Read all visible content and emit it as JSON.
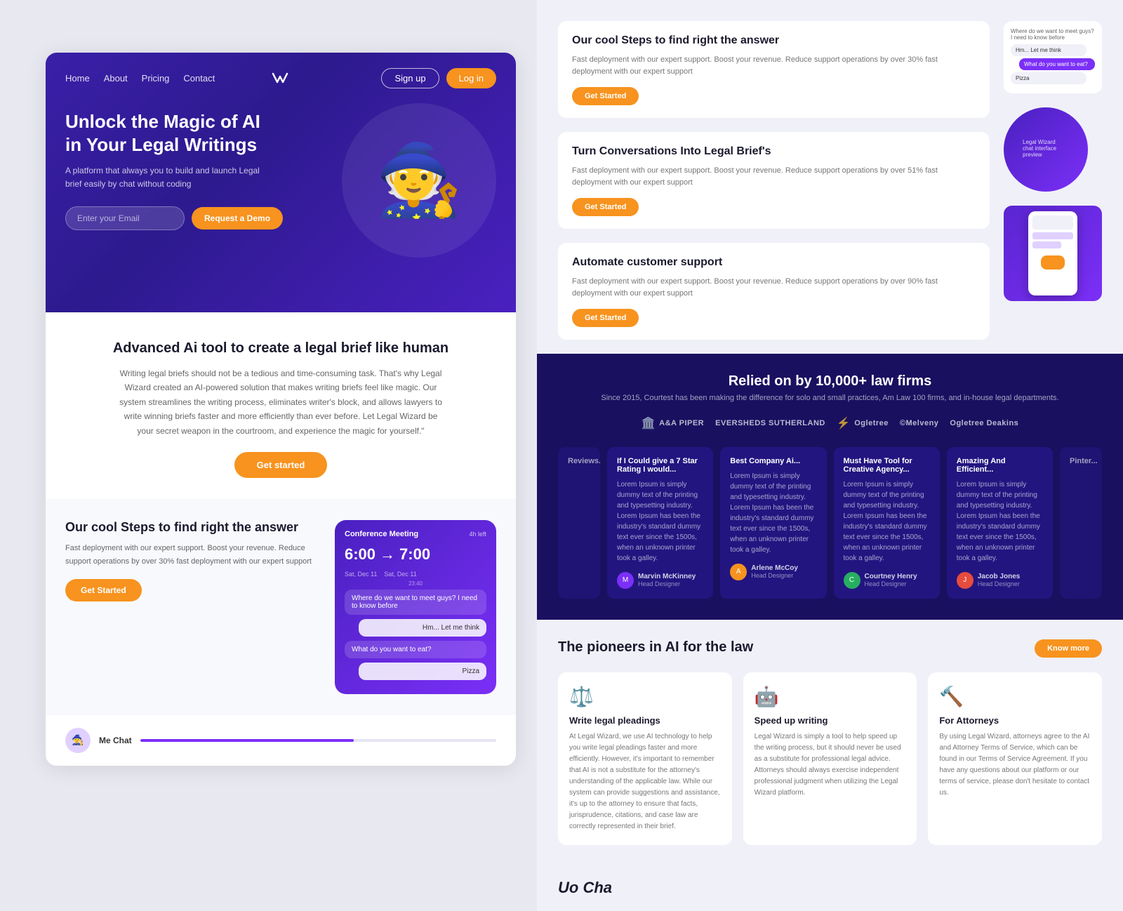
{
  "nav": {
    "links": [
      "Home",
      "About",
      "Pricing",
      "Contact"
    ],
    "signup_label": "Sign up",
    "login_label": "Log in"
  },
  "hero": {
    "title": "Unlock the Magic of AI in Your Legal Writings",
    "subtitle": "A platform that always you to build and launch Legal brief easily by chat without coding",
    "email_placeholder": "Enter your Email",
    "demo_button": "Request a Demo"
  },
  "middle": {
    "title": "Advanced Ai tool to create a legal brief like human",
    "description": "Writing legal briefs should not be a tedious and time-consuming task. That's why Legal Wizard created an AI-powered solution that makes writing briefs feel like magic. Our system streamlines the writing process, eliminates writer's block, and allows lawyers to write winning briefs faster and more efficiently than ever before. Let Legal Wizard be your secret weapon in the courtroom, and experience the magic for yourself.\"",
    "cta_button": "Get started"
  },
  "steps": {
    "title": "Our cool Steps to find right the answer",
    "description": "Fast deployment with our expert support. Boost your revenue. Reduce support operations by over 30% fast deployment with our expert support",
    "cta_button": "Get Started",
    "mockup": {
      "title": "Conference Meeting",
      "time_ago": "4h left",
      "start_time": "6:00",
      "end_time": "7:00",
      "start_date": "Sat, Dec 11",
      "end_date": "Sat, Dec 11",
      "timestamp": "23:40",
      "msg1": "Where do we want to meet guys? I need to know before",
      "msg2": "Hm... Let me think",
      "msg3": "What do you want to eat?",
      "msg4": "Pizza"
    }
  },
  "right_features": [
    {
      "id": "steps",
      "title": "Our cool Steps to find right the answer",
      "description": "Fast deployment with our expert support. Boost your revenue. Reduce support operations by over 30% fast deployment with our expert support",
      "cta": "Get Started"
    },
    {
      "id": "conversations",
      "title": "Turn Conversations Into Legal Brief's",
      "description": "Fast deployment with our expert support. Boost your revenue. Reduce support operations by over 51% fast deployment with our expert support",
      "cta": "Get Started"
    },
    {
      "id": "automate",
      "title": "Automate customer support",
      "description": "Fast deployment with our expert support. Boost your revenue. Reduce support operations by over 90% fast deployment with our expert support",
      "cta": "Get Started"
    }
  ],
  "relied": {
    "title": "Relied on by 10,000+ law firms",
    "subtitle": "Since 2015, Courtest has been making the difference for solo and small practices, Am Law 100 firms, and in-house legal departments.",
    "logos": [
      "A&A PIPER",
      "EVERSHEDS SUTHERLAND",
      "Ogletree",
      "Ogletree Deakins",
      "©Melveny"
    ],
    "testimonials": [
      {
        "title": "If I Could give a 7 Star Rating I would...",
        "description": "Lorem Ipsum is simply dummy text of the printing and typesetting industry. Lorem Ipsum has been the industry's standard dummy text ever since the 1500s, when an unknown printer took a galley.",
        "author": "Marvin McKinney",
        "role": "Head Designer"
      },
      {
        "title": "Best Company Ai...",
        "description": "Lorem Ipsum is simply dummy text of the printing and typesetting industry. Lorem Ipsum has been the industry's standard dummy text ever since the 1500s, when an unknown printer took a galley.",
        "author": "Arlene McCoy",
        "role": "Head Designer"
      },
      {
        "title": "Must Have Tool for Creative Agency...",
        "description": "Lorem Ipsum is simply dummy text of the printing and typesetting industry. Lorem Ipsum has been the industry's standard dummy text ever since the 1500s, when an unknown printer took a galley.",
        "author": "Courtney Henry",
        "role": "Head Designer"
      },
      {
        "title": "Amazing And Efficient...",
        "description": "Lorem Ipsum is simply dummy text of the printing and typesetting industry. Lorem Ipsum has been the industry's standard dummy text ever since the 1500s, when an unknown printer took a galley.",
        "author": "Jacob Jones",
        "role": "Head Designer"
      }
    ]
  },
  "pioneers": {
    "title": "The pioneers in AI for the law",
    "cta": "Know more",
    "cards": [
      {
        "icon": "⚖️",
        "title": "Write legal pleadings",
        "description": "At Legal Wizard, we use AI technology to help you write legal pleadings faster and more efficiently. However, it's important to remember that AI is not a substitute for the attorney's understanding of the applicable law. While our system can provide suggestions and assistance, it's up to the attorney to ensure that facts, jurisprudence, citations, and case law are correctly represented in their brief."
      },
      {
        "icon": "🤖",
        "title": "Speed up writing",
        "description": "Legal Wizard is simply a tool to help speed up the writing process, but it should never be used as a substitute for professional legal advice. Attorneys should always exercise independent professional judgment when utilizing the Legal Wizard platform."
      },
      {
        "icon": "🔨",
        "title": "For Attorneys",
        "description": "By using Legal Wizard, attorneys agree to the AI and Attorney Terms of Service, which can be found in our Terms of Service Agreement. If you have any questions about our platform or our terms of service, please don't hesitate to contact us."
      }
    ]
  },
  "bottom_text": "Uo Cha"
}
